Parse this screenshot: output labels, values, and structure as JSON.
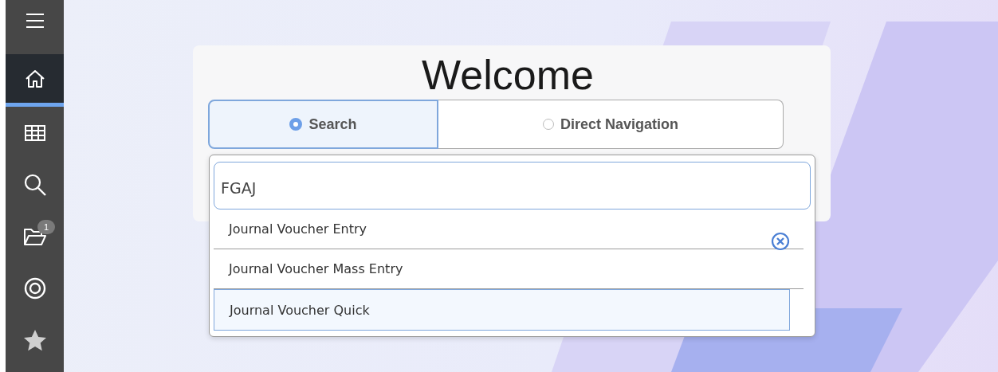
{
  "sidebar": {
    "items": [
      {
        "kind": "menu",
        "selected": false
      },
      {
        "kind": "home",
        "selected": true
      },
      {
        "kind": "grid",
        "selected": false
      },
      {
        "kind": "search",
        "selected": false
      },
      {
        "kind": "folder",
        "selected": false,
        "badge": "1"
      },
      {
        "kind": "target",
        "selected": false
      },
      {
        "kind": "star",
        "selected": false
      }
    ]
  },
  "welcome": {
    "title": "Welcome",
    "tabs": [
      {
        "label": "Search",
        "selected": true
      },
      {
        "label": "Direct Navigation",
        "selected": false
      }
    ],
    "search": {
      "value": "FGAJ"
    },
    "results": [
      {
        "label": "Journal Voucher Entry",
        "selected": false
      },
      {
        "label": "Journal Voucher Mass Entry",
        "selected": false
      },
      {
        "label": "Journal Voucher Quick",
        "selected": true
      }
    ]
  }
}
